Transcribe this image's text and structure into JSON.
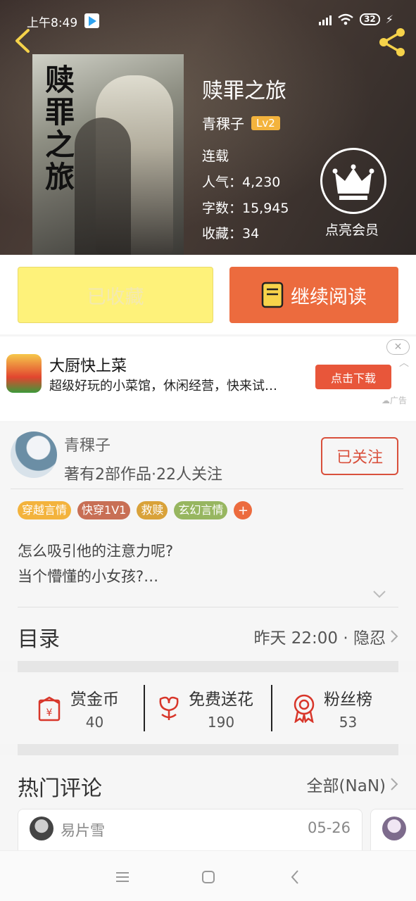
{
  "status_bar": {
    "time": "上午8:49",
    "battery": "32"
  },
  "book": {
    "title": "赎罪之旅",
    "cover_text": "赎罪之旅",
    "author": "青稞子",
    "level": "Lv2",
    "status": "连载",
    "popularity": "人气：4,230",
    "word_count": "字数：15,945",
    "favorites": "收藏：34"
  },
  "vip": {
    "label": "点亮会员"
  },
  "actions": {
    "favorited_label": "已收藏",
    "continue_label": "继续阅读"
  },
  "ad": {
    "title": "大厨快上菜",
    "subtitle": "超级好玩的小菜馆，休闲经营，快来试…",
    "cta": "点击下载",
    "tag": "广告",
    "close": "✕"
  },
  "author_card": {
    "name": "青稞子",
    "works": "著有2部作品·22人关注",
    "follow_label": "已关注"
  },
  "tags": [
    {
      "label": "穿越言情",
      "color": "#f3b33d"
    },
    {
      "label": "快穿1V1",
      "color": "#c86f55"
    },
    {
      "label": "救赎",
      "color": "#d9a23a"
    },
    {
      "label": "玄幻言情",
      "color": "#97b660"
    }
  ],
  "tag_more": "+",
  "intro": {
    "line1": "怎么吸引他的注意力呢?",
    "line2": "当个懵懂的小女孩?…"
  },
  "toc": {
    "title": "目录",
    "latest": "昨天 22:00 · 隐忍"
  },
  "stats": [
    {
      "label": "赏金币",
      "value": "40",
      "icon": "red-envelope-icon"
    },
    {
      "label": "免费送花",
      "value": "190",
      "icon": "flower-icon"
    },
    {
      "label": "粉丝榜",
      "value": "53",
      "icon": "medal-icon"
    }
  ],
  "comments": {
    "title": "热门评论",
    "all_label": "全部(NaN)",
    "items": [
      {
        "user": "易片雪",
        "date": "05-26"
      }
    ]
  },
  "colors": {
    "accent": "#ec6b3e",
    "favorited_bg": "#fef27a",
    "follow": "#d9503c"
  }
}
